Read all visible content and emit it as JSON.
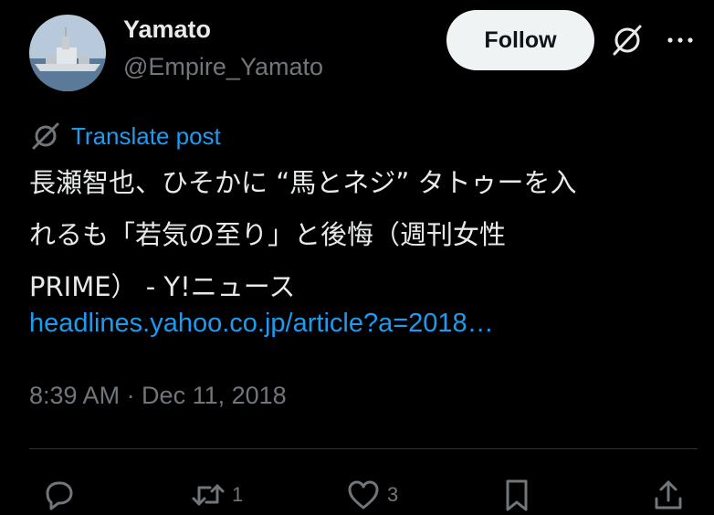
{
  "author": {
    "display_name": "Yamato",
    "handle": "@Empire_Yamato",
    "avatar_icon": "battleship-avatar"
  },
  "header": {
    "follow_label": "Follow",
    "grok_icon": "grok-icon",
    "more_icon": "more-icon"
  },
  "post": {
    "translate_label": "Translate post",
    "text_lines": [
      "長瀬智也、ひそかに “馬とネジ” タトゥーを入",
      "れるも「若気の至り」と後悔（週刊女性",
      "PRIME） - Y!ニュース"
    ],
    "link_text": "headlines.yahoo.co.jp/article?a=2018…",
    "timestamp": "8:39 AM · Dec 11, 2018"
  },
  "actions": {
    "reply_count": "",
    "repost_count": "1",
    "like_count": "3"
  },
  "colors": {
    "background": "#000000",
    "text": "#e7e9ea",
    "secondary": "#71767b",
    "link": "#1d9bf0",
    "follow_bg": "#eff3f4",
    "divider": "#2f3336"
  }
}
